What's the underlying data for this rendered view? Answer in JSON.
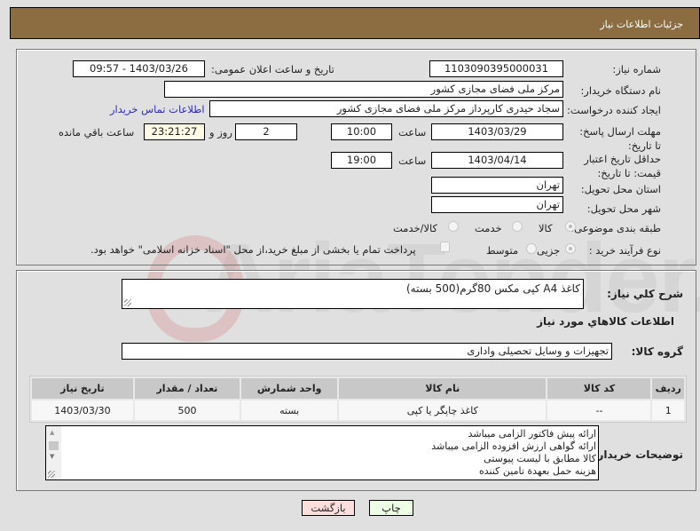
{
  "header": {
    "title": "جزئیات اطلاعات نیاز"
  },
  "form": {
    "need_number": {
      "label": "شماره نیاز:",
      "value": "1103090395000031"
    },
    "announce": {
      "label": "تاریخ و ساعت اعلان عمومی:",
      "value": "1403/03/26 - 09:57"
    },
    "buyer_org": {
      "label": "نام دستگاه خریدار:",
      "value": "مرکز ملی فضای مجازی کشور"
    },
    "creator": {
      "label": "ایجاد کننده درخواست:",
      "value": "سجاد حیدری کارپرداز مرکز ملی فضای مجازی کشور",
      "contact_link": "اطلاعات تماس خریدار"
    },
    "deadline": {
      "label": "مهلت ارسال پاسخ: تا تاریخ:",
      "date": "1403/03/29",
      "time_label": "ساعت",
      "time": "10:00",
      "days": "2",
      "days_label": "روز و",
      "remaining": "23:21:27",
      "remaining_label": "ساعت باقي مانده"
    },
    "price_validity": {
      "label": "حداقل تاریخ اعتبار قیمت: تا تاریخ:",
      "date": "1403/04/14",
      "time_label": "ساعت",
      "time": "19:00"
    },
    "province": {
      "label": "استان محل تحویل:",
      "value": "تهران"
    },
    "city": {
      "label": "شهر محل تحویل:",
      "value": "تهران"
    },
    "category": {
      "label": "طبقه بندی موضوعی:",
      "options": [
        {
          "label": "کالا",
          "selected": true
        },
        {
          "label": "خدمت",
          "selected": false
        },
        {
          "label": "کالا/خدمت",
          "selected": false
        }
      ]
    },
    "purchase_type": {
      "label": "نوع فرآیند خرید :",
      "options": [
        {
          "label": "جزیی",
          "selected": true
        },
        {
          "label": "متوسط",
          "selected": false
        }
      ],
      "treasury_note": "پرداخت تمام یا بخشی از مبلغ خرید،از محل \"اسناد خزانه اسلامی\" خواهد بود."
    }
  },
  "details": {
    "summary_label": "شرح کلي نياز:",
    "summary_value": "کاغذ A4 کپی مکس 80گرم(500 بسته)",
    "goods_info_title": "اطلاعات کالاهاي مورد نياز",
    "goods_group_label": "گروه کالا:",
    "goods_group_value": "تجهیزات و وسایل تحصیلی واداری",
    "table": {
      "headers": [
        "ردیف",
        "کد کالا",
        "نام کالا",
        "واحد شمارش",
        "تعداد / مقدار",
        "تاریخ نیاز"
      ],
      "rows": [
        [
          "1",
          "--",
          "کاغذ چاپگر یا کپی",
          "بسته",
          "500",
          "1403/03/30"
        ]
      ]
    },
    "buyer_notes_label": "توضیحات خریدار:",
    "buyer_notes_lines": [
      "ارائه پیش فاکتور الزامی میباشد",
      "ارائه گواهی ارزش افزوده الزامی میباشد",
      "کالا مطابق با لیست پیوستی",
      "هزینه حمل بعهدة تامین کننده"
    ]
  },
  "buttons": {
    "print": "چاپ",
    "back": "بازگشت"
  },
  "watermark": {
    "text": "AriaTender.net"
  }
}
